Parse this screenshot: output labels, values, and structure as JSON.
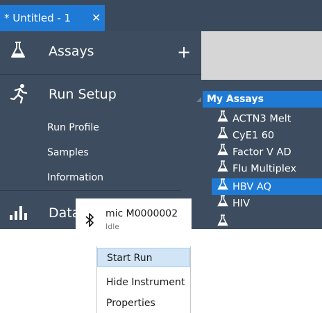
{
  "tab": {
    "title": "* Untitled - 1",
    "close": "✕"
  },
  "nav": {
    "assays": {
      "label": "Assays",
      "icon": "flask-icon",
      "add": "+"
    },
    "run_setup": {
      "label": "Run Setup",
      "icon": "runner-icon",
      "items": [
        {
          "label": "Run Profile"
        },
        {
          "label": "Samples"
        },
        {
          "label": "Information"
        }
      ]
    },
    "data": {
      "label": "Data",
      "icon": "bar-chart-icon"
    }
  },
  "tree": {
    "header": "My Assays",
    "items": [
      {
        "label": "ACTN3 Melt"
      },
      {
        "label": "CyE1 60"
      },
      {
        "label": "Factor V AD"
      },
      {
        "label": "Flu Multiplex"
      },
      {
        "label": "HBV AQ",
        "selected": true
      },
      {
        "label": "HIV"
      },
      {
        "label": ""
      }
    ]
  },
  "instrument": {
    "name": "mic M0000002",
    "status": "Idle",
    "icon": "bluetooth-icon"
  },
  "menu": {
    "items": [
      {
        "label": "Start Run",
        "highlighted": true
      },
      {
        "label": "Hide Instrument"
      },
      {
        "label": "Properties"
      }
    ]
  },
  "colors": {
    "accent": "#1e7ad4",
    "nav_bg": "#3d4d5f",
    "tabstrip_bg": "#3a4a5c",
    "workspace": "#d6d6d6",
    "menu_highlight": "#d2e5f6"
  }
}
